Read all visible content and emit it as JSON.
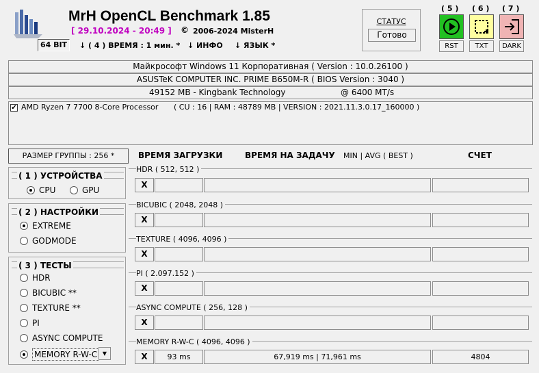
{
  "app": {
    "title": "MrH OpenCL Benchmark 1.85",
    "datetime": "[ 29.10.2024 - 20:49 ]",
    "copyright": "2006-2024 MisterH",
    "copyright_symbol": "©"
  },
  "toolbar": {
    "bits": "64 BIT",
    "time_menu": "↓ ( 4 ) ВРЕМЯ : 1 мин. *",
    "info_menu": "↓ ИНФО",
    "lang_menu": "↓ ЯЗЫК *"
  },
  "status": {
    "label": "СТАТУС",
    "value": "Готово"
  },
  "action_buttons": [
    {
      "number": "( 5 )",
      "label": "RST",
      "color": "#22c022",
      "icon": "play-icon"
    },
    {
      "number": "( 6 )",
      "label": "TXT",
      "color": "#ffffa0",
      "icon": "crop-icon"
    },
    {
      "number": "( 7 )",
      "label": "DARK",
      "color": "#f0b4b4",
      "icon": "exit-icon"
    }
  ],
  "system": {
    "os": "Майкрософт Windows 11 Корпоративная ( Version : 10.0.26100 )",
    "board": "ASUSTeK COMPUTER INC. PRIME B650M-R ( BIOS Version : 3040 )",
    "memory": "49152 MB - Kingbank Technology",
    "memory_speed": "@ 6400 MT/s"
  },
  "device": {
    "name": "AMD Ryzen 7 7700 8-Core Processor",
    "details": "( CU : 16 | RAM : 48789 MB | VERSION : 2021.11.3.0.17_160000 )",
    "checked": true
  },
  "headers": {
    "group_size": "РАЗМЕР ГРУППЫ : 256 *",
    "load_time": "ВРЕМЯ ЗАГРУЗКИ",
    "task_time": "ВРЕМЯ НА ЗАДАЧУ",
    "min_avg": "MIN | AVG ( BEST )",
    "score": "СЧЕТ"
  },
  "devices_group": {
    "title": "( 1 ) УСТРОЙСТВА",
    "options": [
      "CPU",
      "GPU"
    ],
    "selected": "CPU"
  },
  "settings_group": {
    "title": "( 2 ) НАСТРОЙКИ",
    "options": [
      "EXTREME",
      "GODMODE"
    ],
    "selected": "EXTREME"
  },
  "tests_group": {
    "title": "( 3 ) ТЕСТЫ",
    "options": [
      "HDR",
      "BICUBIC **",
      "TEXTURE **",
      "PI",
      "ASYNC COMPUTE",
      "MEMORY R-W-C"
    ],
    "selected": "MEMORY R-W-C"
  },
  "tests": [
    {
      "name": "HDR ( 512, 512 )",
      "x": "X",
      "load": "",
      "task": "",
      "score": ""
    },
    {
      "name": "BICUBIC ( 2048, 2048 )",
      "x": "X",
      "load": "",
      "task": "",
      "score": ""
    },
    {
      "name": "TEXTURE ( 4096, 4096 )",
      "x": "X",
      "load": "",
      "task": "",
      "score": ""
    },
    {
      "name": "PI ( 2.097.152 )",
      "x": "X",
      "load": "",
      "task": "",
      "score": ""
    },
    {
      "name": "ASYNC COMPUTE ( 256, 128 )",
      "x": "X",
      "load": "",
      "task": "",
      "score": ""
    },
    {
      "name": "MEMORY R-W-C ( 4096, 4096 )",
      "x": "X",
      "load": "93 ms",
      "task": "67,919 ms | 71,961 ms",
      "score": "4804"
    }
  ]
}
